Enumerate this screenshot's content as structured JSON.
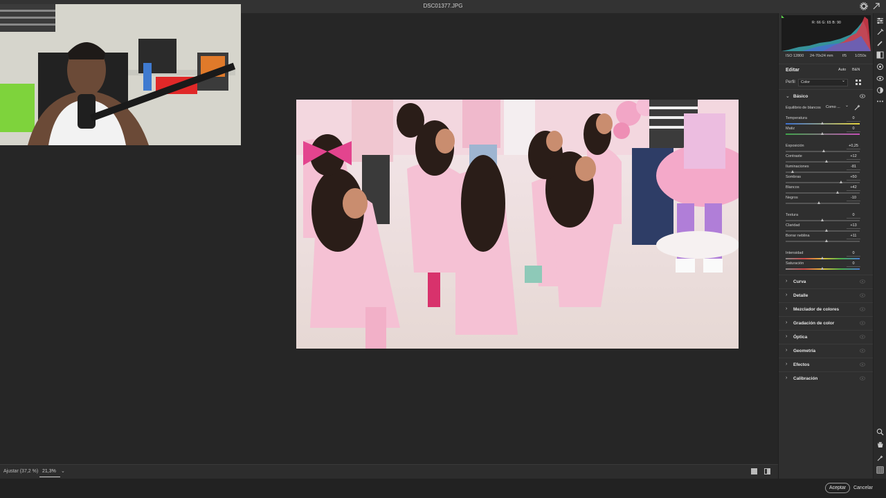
{
  "window": {
    "file_name": "DSC01377.JPG"
  },
  "canvas": {
    "zoom_fit_label": "Ajustar (37,2 %)",
    "zoom_value": "21,3%"
  },
  "footer": {
    "accept_label": "Aceptar",
    "cancel_label": "Cancelar"
  },
  "histogram": {
    "readout": "R: 66   G: 65   B: 90"
  },
  "camera": {
    "iso": "ISO 12800",
    "focal": "24-70x24 mm",
    "aperture": "f/5",
    "shutter": "1/250s"
  },
  "edit": {
    "title": "Editar",
    "auto_label": "Auto",
    "bw_label": "B&N",
    "profile_label": "Perfil",
    "profile_value": "Color",
    "basic": {
      "title": "Básico",
      "wb_label": "Equilibrio de blancos",
      "wb_value": "Como ...",
      "sliders": [
        {
          "label": "Temperatura",
          "value": "0",
          "pos": 0.5
        },
        {
          "label": "Matiz",
          "value": "0",
          "pos": 0.5
        },
        {
          "label": "Exposición",
          "value": "+0,25",
          "pos": 0.52
        },
        {
          "label": "Contraste",
          "value": "+12",
          "pos": 0.56
        },
        {
          "label": "Iluminaciones",
          "value": "-81",
          "pos": 0.1
        },
        {
          "label": "Sombras",
          "value": "+50",
          "pos": 0.75
        },
        {
          "label": "Blancos",
          "value": "+42",
          "pos": 0.71
        },
        {
          "label": "Negros",
          "value": "-10",
          "pos": 0.45
        },
        {
          "label": "Textura",
          "value": "0",
          "pos": 0.5
        },
        {
          "label": "Claridad",
          "value": "+13",
          "pos": 0.56
        },
        {
          "label": "Borrar neblina",
          "value": "+11",
          "pos": 0.56
        },
        {
          "label": "Intensidad",
          "value": "0",
          "pos": 0.5
        },
        {
          "label": "Saturación",
          "value": "0",
          "pos": 0.5
        }
      ]
    },
    "sections": [
      "Curva",
      "Detalle",
      "Mezclador de colores",
      "Gradación de color",
      "Óptica",
      "Geometría",
      "Efectos",
      "Calibración"
    ]
  }
}
